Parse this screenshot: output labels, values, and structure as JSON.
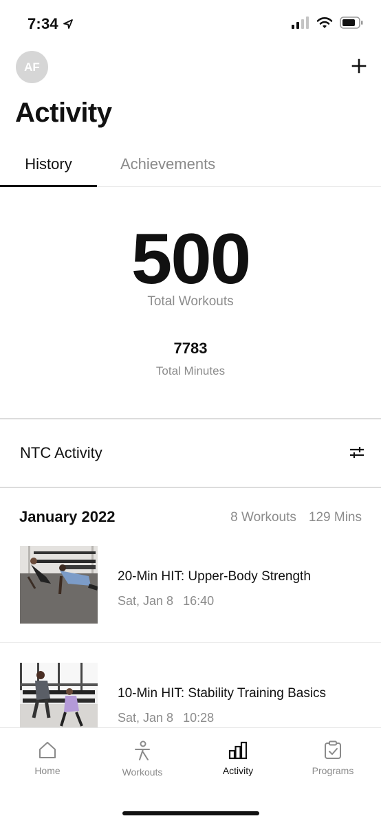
{
  "status_bar": {
    "time": "7:34"
  },
  "header": {
    "avatar_initials": "AF",
    "title": "Activity"
  },
  "tabs": [
    {
      "label": "History",
      "active": true
    },
    {
      "label": "Achievements",
      "active": false
    }
  ],
  "stats": {
    "total_workouts": "500",
    "total_workouts_label": "Total Workouts",
    "total_minutes": "7783",
    "total_minutes_label": "Total Minutes"
  },
  "section": {
    "title": "NTC Activity"
  },
  "month": {
    "title": "January 2022",
    "workouts": "8 Workouts",
    "mins": "129 Mins"
  },
  "workouts": [
    {
      "title": "20-Min HIT: Upper-Body Strength",
      "day": "Sat, Jan 8",
      "time": "16:40"
    },
    {
      "title": "10-Min HIT: Stability Training Basics",
      "day": "Sat, Jan 8",
      "time": "10:28"
    }
  ],
  "nav": [
    {
      "label": "Home",
      "icon": "home-icon",
      "active": false
    },
    {
      "label": "Workouts",
      "icon": "runner-icon",
      "active": false
    },
    {
      "label": "Activity",
      "icon": "bar-chart-icon",
      "active": true
    },
    {
      "label": "Programs",
      "icon": "clipboard-check-icon",
      "active": false
    }
  ]
}
